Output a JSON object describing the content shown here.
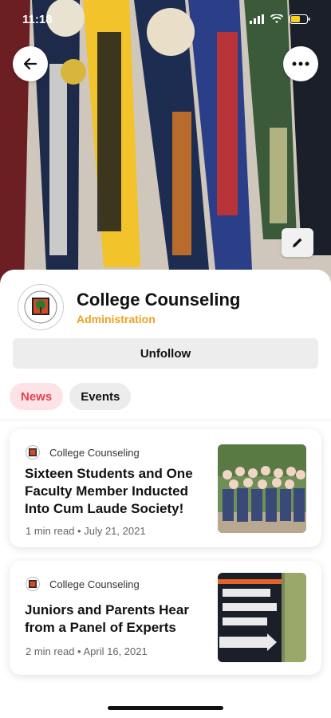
{
  "status_bar": {
    "time": "11:18"
  },
  "header": {
    "back_icon": "arrow-left-icon",
    "more_icon": "ellipsis-icon",
    "edit_icon": "pencil-icon"
  },
  "profile": {
    "name": "College Counseling",
    "subtitle": "Administration",
    "accent_color": "#f0a020"
  },
  "follow_button": {
    "label": "Unfollow"
  },
  "tabs": [
    {
      "label": "News",
      "active": true
    },
    {
      "label": "Events",
      "active": false
    }
  ],
  "articles": [
    {
      "source": "College Counseling",
      "title": "Sixteen Students and One Faculty Member Inducted Into Cum Laude Society!",
      "read_time": "1 min read",
      "date": "July 21, 2021",
      "thumbnail": "group-photo"
    },
    {
      "source": "College Counseling",
      "title": "Juniors and Parents Hear from a Panel of Experts",
      "read_time": "2 min read",
      "date": "April 16, 2021",
      "thumbnail": "admissions-office-sign"
    }
  ],
  "colors": {
    "active_tab_bg": "#fde3e6",
    "active_tab_text": "#e8434f"
  }
}
